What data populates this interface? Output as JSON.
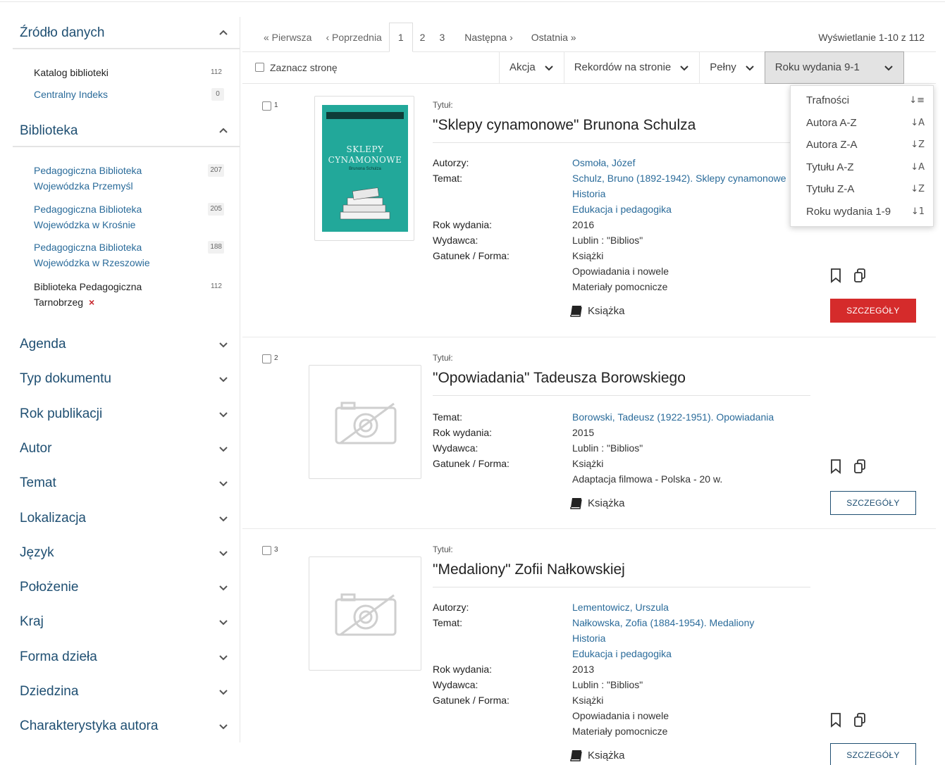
{
  "sidebar": {
    "source_title": "Źródło danych",
    "source_items": [
      {
        "label": "Katalog biblioteki",
        "count": "112"
      },
      {
        "label": "Centralny Indeks",
        "count": "0"
      }
    ],
    "library_title": "Biblioteka",
    "library_items": [
      {
        "label": "Pedagogiczna Biblioteka Wojewódzka Przemyśl",
        "count": "207"
      },
      {
        "label": "Pedagogiczna Biblioteka Wojewódzka w Krośnie",
        "count": "205"
      },
      {
        "label": "Pedagogiczna Biblioteka Wojewódzka w Rzeszowie",
        "count": "188"
      },
      {
        "label": "Biblioteka Pedagogiczna Tarnobrzeg",
        "count": "112",
        "remove": "×"
      }
    ],
    "facets": [
      "Agenda",
      "Typ dokumentu",
      "Rok publikacji",
      "Autor",
      "Temat",
      "Lokalizacja",
      "Język",
      "Położenie",
      "Kraj",
      "Forma dzieła",
      "Dziedzina",
      "Charakterystyka autora"
    ]
  },
  "pager": {
    "first": "« Pierwsza",
    "prev": "‹ Poprzednia",
    "pages": [
      "1",
      "2",
      "3"
    ],
    "next": "Następna ›",
    "last": "Ostatnia »",
    "info": "Wyświetlanie 1-10 z 112"
  },
  "toolbar": {
    "select_page": "Zaznacz stronę",
    "action": "Akcja",
    "per_page": "Rekordów na stronie",
    "view": "Pełny",
    "sort": "Roku wydania 9-1"
  },
  "sort_options": [
    {
      "label": "Trafności",
      "icon": "↓≡"
    },
    {
      "label": "Autora A-Z",
      "icon": "↓A"
    },
    {
      "label": "Autora Z-A",
      "icon": "↓Z"
    },
    {
      "label": "Tytułu A-Z",
      "icon": "↓A"
    },
    {
      "label": "Tytułu Z-A",
      "icon": "↓Z"
    },
    {
      "label": "Roku wydania 1-9",
      "icon": "↓1"
    }
  ],
  "results": [
    {
      "num": "1",
      "title_label": "Tytuł:",
      "title": "\"Sklepy cynamonowe\" Brunona Schulza",
      "cover_text": "SKLEPY CYNAMONOWE",
      "cover_sub": "Brunona Schulza",
      "fields": [
        {
          "label": "Autorzy:",
          "values": [
            "Osmoła, Józef"
          ],
          "link": true
        },
        {
          "label": "Temat:",
          "values": [
            "Schulz, Bruno (1892-1942). Sklepy cynamonowe",
            "Historia",
            "Edukacja i pedagogika"
          ],
          "link": true
        },
        {
          "label": "Rok wydania:",
          "values": [
            "2016"
          ],
          "link": false
        },
        {
          "label": "Wydawca:",
          "values": [
            "Lublin : \"Biblios\""
          ],
          "link": false
        },
        {
          "label": "Gatunek / Forma:",
          "values": [
            "Książki",
            "Opowiadania i nowele",
            "Materiały pomocnicze"
          ],
          "link": false
        }
      ],
      "doc_type": "Książka",
      "details": "SZCZEGÓŁY"
    },
    {
      "num": "2",
      "title_label": "Tytuł:",
      "title": "\"Opowiadania\" Tadeusza Borowskiego",
      "fields": [
        {
          "label": "Temat:",
          "values": [
            "Borowski, Tadeusz (1922-1951). Opowiadania"
          ],
          "link": true
        },
        {
          "label": "Rok wydania:",
          "values": [
            "2015"
          ],
          "link": false
        },
        {
          "label": "Wydawca:",
          "values": [
            "Lublin : \"Biblios\""
          ],
          "link": false
        },
        {
          "label": "Gatunek / Forma:",
          "values": [
            "Książki",
            "Adaptacja filmowa - Polska - 20 w."
          ],
          "link": false
        }
      ],
      "doc_type": "Książka",
      "details": "SZCZEGÓŁY"
    },
    {
      "num": "3",
      "title_label": "Tytuł:",
      "title": "\"Medaliony\" Zofii Nałkowskiej",
      "fields": [
        {
          "label": "Autorzy:",
          "values": [
            "Lementowicz, Urszula"
          ],
          "link": true
        },
        {
          "label": "Temat:",
          "values": [
            "Nałkowska, Zofia (1884-1954). Medaliony",
            "Historia",
            "Edukacja i pedagogika"
          ],
          "link": true
        },
        {
          "label": "Rok wydania:",
          "values": [
            "2013"
          ],
          "link": false
        },
        {
          "label": "Wydawca:",
          "values": [
            "Lublin : \"Biblios\""
          ],
          "link": false
        },
        {
          "label": "Gatunek / Forma:",
          "values": [
            "Książki",
            "Opowiadania i nowele",
            "Materiały pomocnicze"
          ],
          "link": false
        }
      ],
      "doc_type": "Książka",
      "details": "SZCZEGÓŁY"
    }
  ],
  "colors": {
    "accent": "#1f4f72",
    "link": "#2a6b9a",
    "danger": "#d52b2b",
    "cover": "#22a89a"
  }
}
